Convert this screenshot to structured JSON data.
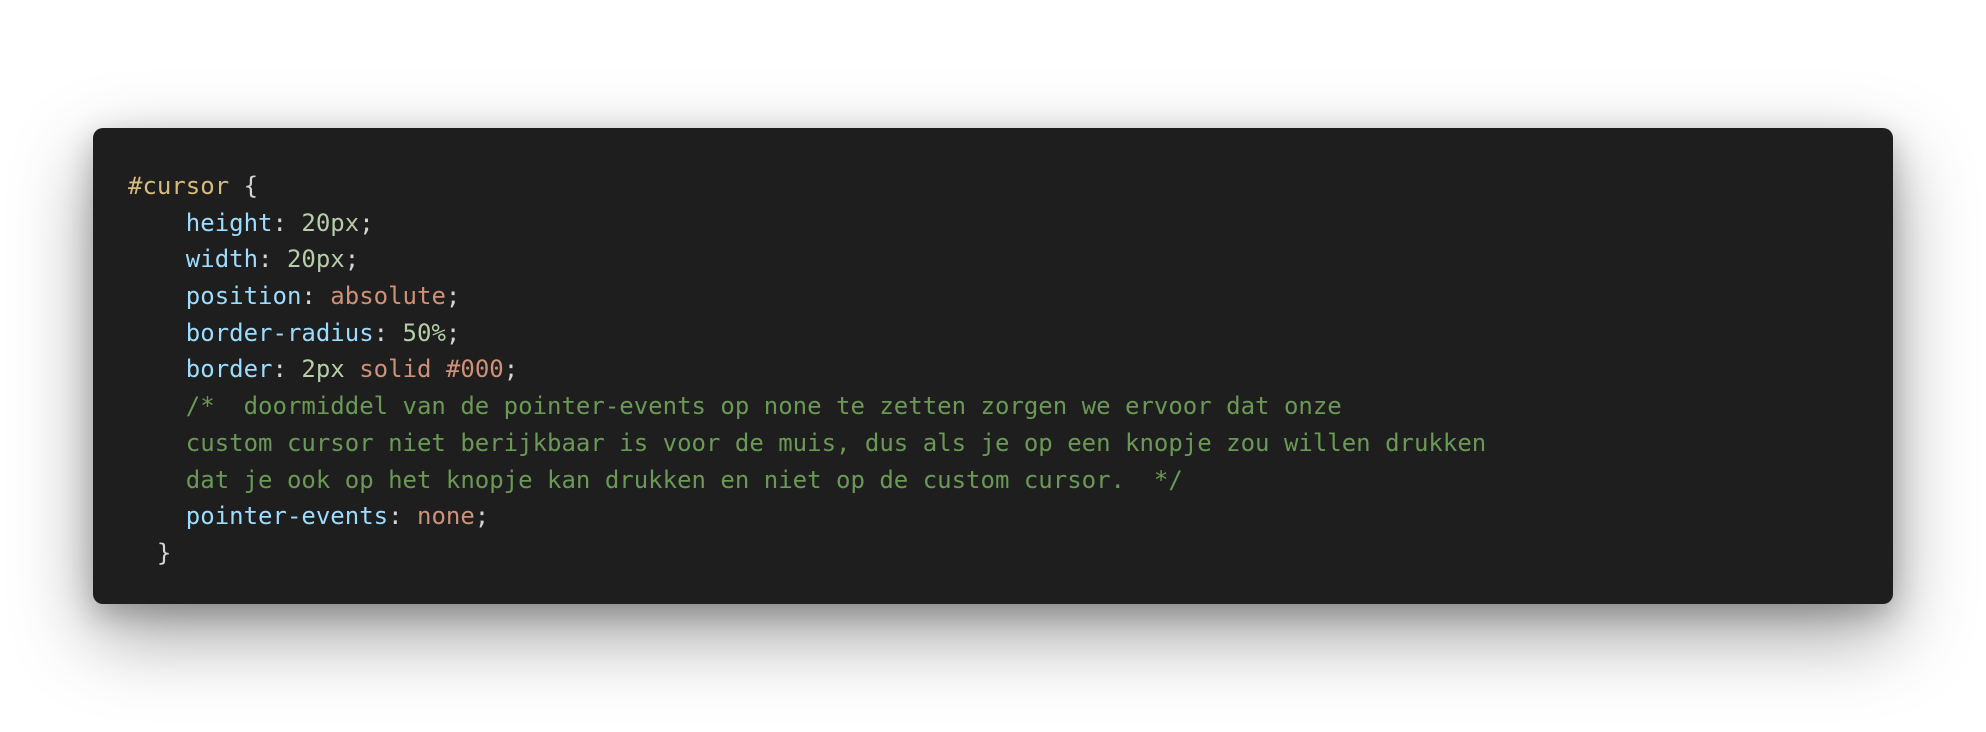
{
  "code": {
    "selector": "#cursor",
    "open_brace": " {",
    "close_brace": "  }",
    "declarations": [
      {
        "indent": "    ",
        "property": "height",
        "value_parts": [
          {
            "text": "20px",
            "type": "num"
          }
        ]
      },
      {
        "indent": "    ",
        "property": "width",
        "value_parts": [
          {
            "text": "20px",
            "type": "num"
          }
        ]
      },
      {
        "indent": "    ",
        "property": "position",
        "value_parts": [
          {
            "text": "absolute",
            "type": "str"
          }
        ]
      },
      {
        "indent": "    ",
        "property": "border-radius",
        "value_parts": [
          {
            "text": "50%",
            "type": "num"
          }
        ]
      },
      {
        "indent": "    ",
        "property": "border",
        "value_parts": [
          {
            "text": "2px",
            "type": "num"
          },
          {
            "text": " ",
            "type": "punc"
          },
          {
            "text": "solid",
            "type": "str"
          },
          {
            "text": " ",
            "type": "punc"
          },
          {
            "text": "#000",
            "type": "str"
          }
        ]
      }
    ],
    "comment_lines": [
      "    /*  doormiddel van de pointer-events op none te zetten zorgen we ervoor dat onze",
      "    custom cursor niet berijkbaar is voor de muis, dus als je op een knopje zou willen drukken",
      "    dat je ook op het knopje kan drukken en niet op de custom cursor.  */"
    ],
    "last_declaration": {
      "indent": "    ",
      "property": "pointer-events",
      "value_parts": [
        {
          "text": "none",
          "type": "str"
        }
      ]
    }
  },
  "colors": {
    "background": "#1e1e1e",
    "selector": "#d7ba7d",
    "property": "#9cdcfe",
    "number": "#b5cea8",
    "string": "#ce9178",
    "comment": "#6a9955",
    "punctuation": "#d4d4d4"
  }
}
